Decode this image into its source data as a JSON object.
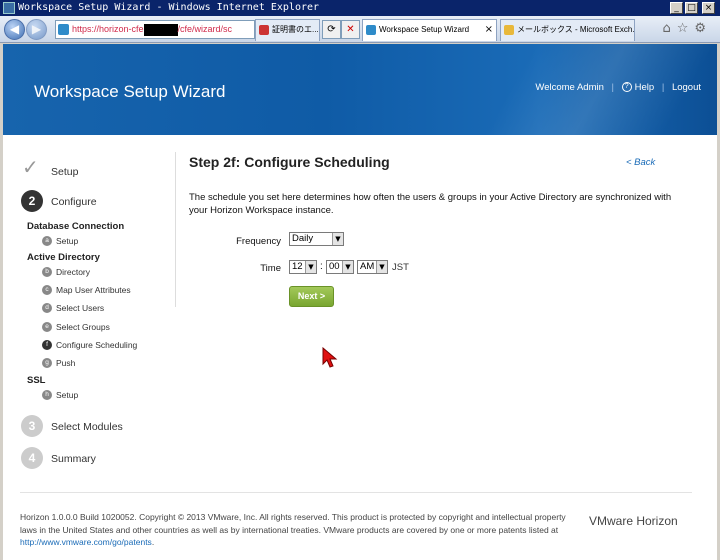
{
  "window": {
    "title": "Workspace Setup Wizard - Windows Internet Explorer",
    "min": "_",
    "max": "□",
    "close": "×"
  },
  "browser": {
    "address_prefix": "https://horizon-cfe",
    "address_suffix": "/cfe/wizard/sc",
    "tabs": [
      {
        "label": "証明書のエ..."
      },
      {
        "label": "Workspace Setup Wizard"
      },
      {
        "label": "メールボックス - Microsoft Exch..."
      }
    ],
    "right_icons": "⌂☆⚙"
  },
  "header": {
    "title": "Workspace Setup Wizard",
    "welcome": "Welcome Admin",
    "help": "Help",
    "logout": "Logout",
    "separator": "|"
  },
  "steps": {
    "setup": {
      "label": "Setup",
      "done_icon": "check-icon"
    },
    "configure": {
      "number": "2",
      "label": "Configure"
    },
    "groups": [
      {
        "title": "Database Connection",
        "items": [
          {
            "letter": "a",
            "label": "Setup"
          }
        ]
      },
      {
        "title": "Active Directory",
        "items": [
          {
            "letter": "b",
            "label": "Directory"
          },
          {
            "letter": "c",
            "label": "Map User Attributes"
          },
          {
            "letter": "d",
            "label": "Select Users"
          },
          {
            "letter": "e",
            "label": "Select Groups"
          },
          {
            "letter": "f",
            "label": "Configure Scheduling"
          },
          {
            "letter": "g",
            "label": "Push"
          }
        ]
      },
      {
        "title": "SSL",
        "items": [
          {
            "letter": "h",
            "label": "Setup"
          }
        ]
      }
    ],
    "select_modules": {
      "number": "3",
      "label": "Select Modules"
    },
    "summary": {
      "number": "4",
      "label": "Summary"
    }
  },
  "main": {
    "heading": "Step 2f: Configure Scheduling",
    "back": "< Back",
    "description": "The schedule you set here determines how often the users & groups in your Active Directory are synchronized with your Horizon Workspace instance.",
    "frequency_label": "Frequency",
    "frequency_value": "Daily",
    "time_label": "Time",
    "hour": "12",
    "minute": "00",
    "ampm": "AM",
    "colon": ":",
    "timezone": "JST",
    "next": "Next >"
  },
  "footer": {
    "text": "Horizon 1.0.0.0 Build 1020052. Copyright © 2013 VMware, Inc. All rights reserved. This product is protected by copyright and intellectual property laws in the United States and other countries as well as by international treaties. VMware products are covered by one or more patents listed at",
    "link": "http://www.vmware.com/go/patents",
    "period": ".",
    "brand": "VMware Horizon"
  },
  "colors": {
    "banner": "#1764ad",
    "accent": "#1a6bb7",
    "next_button": "#8ab843",
    "active_step": "#333333",
    "inactive_step": "#cccccc"
  }
}
